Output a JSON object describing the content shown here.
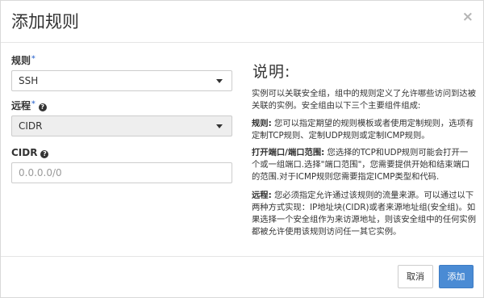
{
  "dialog": {
    "title": "添加规则",
    "close_symbol": "×"
  },
  "form": {
    "rule": {
      "label": "规则",
      "required": "*",
      "value": "SSH"
    },
    "remote": {
      "label": "远程",
      "required": "*",
      "help": "?",
      "value": "CIDR"
    },
    "cidr": {
      "label": "CIDR",
      "help": "?",
      "placeholder": "0.0.0.0/0"
    }
  },
  "description": {
    "title": "说明:",
    "intro": "实例可以关联安全组，组中的规则定义了允许哪些访问到达被关联的实例。安全组由以下三个主要组件组成:",
    "rule_term": "规则:",
    "rule_text": " 您可以指定期望的规则模板或者使用定制规则，选项有定制TCP规则、定制UDP规则或定制ICMP规则。",
    "port_term": "打开端口/端口范围:",
    "port_text": " 您选择的TCP和UDP规则可能会打开一个或一组端口.选择\"端口范围\"，您需要提供开始和结束端口的范围.对于ICMP规则您需要指定ICMP类型和代码.",
    "remote_term": "远程:",
    "remote_text": " 您必须指定允许通过该规则的流量来源。可以通过以下两种方式实现：IP地址块(CIDR)或者来源地址组(安全组)。如果选择一个安全组作为来访源地址，则该安全组中的任何实例都被允许使用该规则访问任一其它实例。"
  },
  "footer": {
    "cancel_label": "取消",
    "add_label": "添加"
  },
  "colors": {
    "primary": "#4a8bd4",
    "required_marker": "#4a7ad3"
  }
}
